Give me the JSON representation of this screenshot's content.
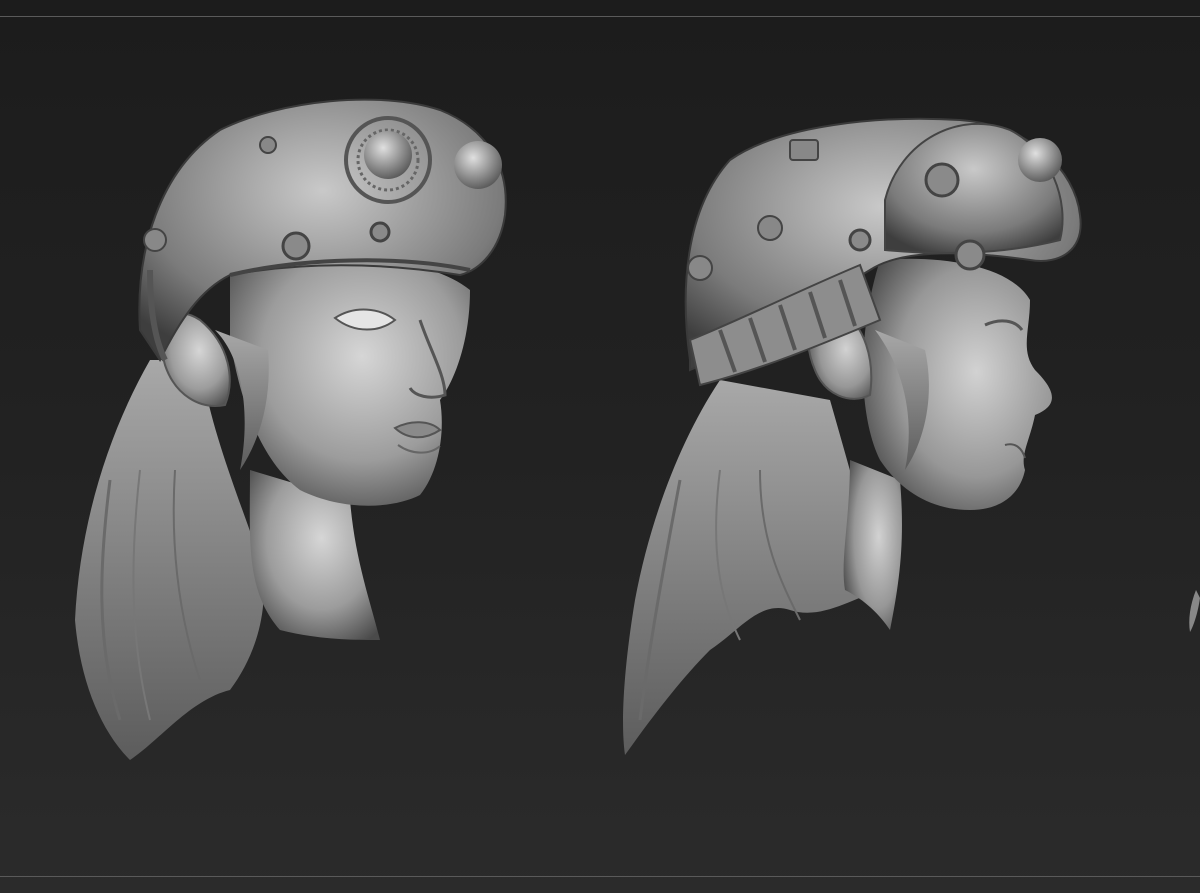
{
  "scene": {
    "background_color": "#222222",
    "rule_color": "#5a5a5a",
    "material_color": "#9a9a9a",
    "views": [
      {
        "name": "three-quarter-view"
      },
      {
        "name": "side-profile-view"
      }
    ]
  }
}
